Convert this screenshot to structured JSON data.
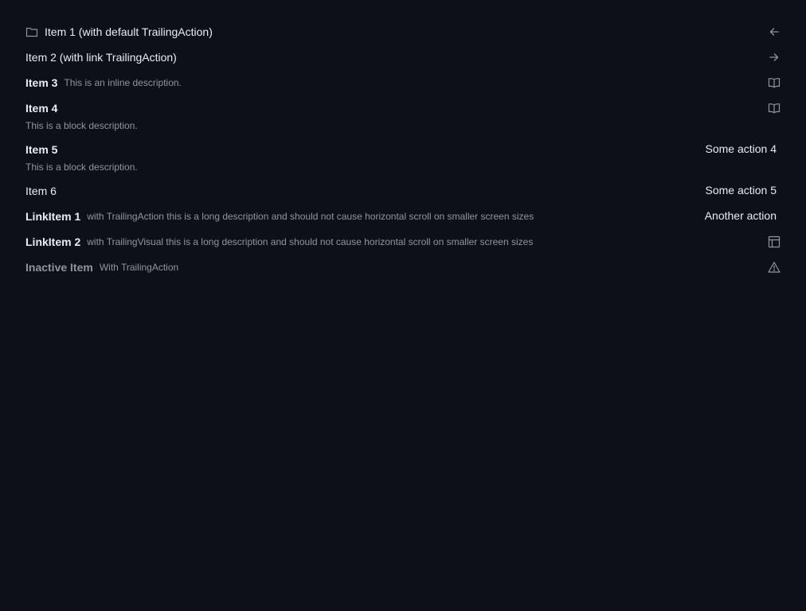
{
  "items": [
    {
      "label": "Item 1 (with default TrailingAction)",
      "lead_icon": "folder-icon",
      "trailing_icon": "arrow-left-icon"
    },
    {
      "label": "Item 2 (with link TrailingAction)",
      "trailing_icon": "arrow-right-icon"
    },
    {
      "label": "Item 3",
      "inline_description": "This is an inline description.",
      "trailing_icon": "book-icon"
    },
    {
      "label": "Item 4",
      "block_description": "This is a block description.",
      "trailing_icon": "book-icon"
    },
    {
      "label": "Item 5",
      "block_description": "This is a block description.",
      "trailing_action": "Some action 4"
    },
    {
      "label": "Item 6",
      "trailing_action": "Some action 5"
    },
    {
      "label": "LinkItem 1",
      "inline_description": "with TrailingAction this is a long description and should not cause horizontal scroll on smaller screen sizes",
      "trailing_action": "Another action"
    },
    {
      "label": "LinkItem 2",
      "inline_description": "with TrailingVisual this is a long description and should not cause horizontal scroll on smaller screen sizes",
      "trailing_icon": "table-icon"
    },
    {
      "label": "Inactive Item",
      "inline_description": "With TrailingAction",
      "trailing_icon": "alert-icon"
    }
  ],
  "colors": {
    "background": "#0d1117",
    "text": "#e6edf3",
    "muted": "#8d96a0"
  }
}
